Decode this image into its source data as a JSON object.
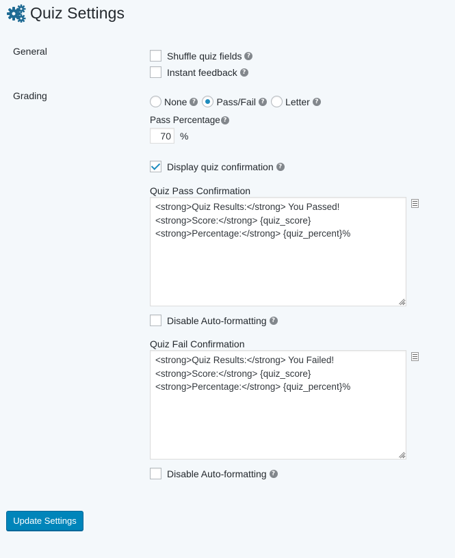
{
  "page": {
    "title": "Quiz Settings",
    "title_icon": "gears-icon",
    "accent_color": "#0085ba"
  },
  "general": {
    "label": "General",
    "shuffle": {
      "label": "Shuffle quiz fields",
      "checked": false
    },
    "instant_feedback": {
      "label": "Instant feedback",
      "checked": false
    }
  },
  "grading": {
    "label": "Grading",
    "options": [
      {
        "label": "None",
        "selected": false
      },
      {
        "label": "Pass/Fail",
        "selected": true
      },
      {
        "label": "Letter",
        "selected": false
      }
    ],
    "pass_percentage": {
      "label": "Pass Percentage",
      "value": "70",
      "unit": "%"
    },
    "display_confirmation": {
      "label": "Display quiz confirmation",
      "checked": true
    }
  },
  "pass_confirmation": {
    "label": "Quiz Pass Confirmation",
    "lines": [
      "<strong>Quiz Results:</strong> You Passed!",
      "<strong>Score:</strong> {quiz_score}",
      "<strong>Percentage:</strong> {quiz_percent}%"
    ],
    "disable_autoformat": {
      "label": "Disable Auto-formatting",
      "checked": false
    }
  },
  "fail_confirmation": {
    "label": "Quiz Fail Confirmation",
    "lines": [
      "<strong>Quiz Results:</strong> You Failed!",
      "<strong>Score:</strong> {quiz_score}",
      "<strong>Percentage:</strong> {quiz_percent}%"
    ],
    "disable_autoformat": {
      "label": "Disable Auto-formatting",
      "checked": false
    }
  },
  "help_icon_glyph": "?",
  "submit": {
    "label": "Update Settings"
  }
}
